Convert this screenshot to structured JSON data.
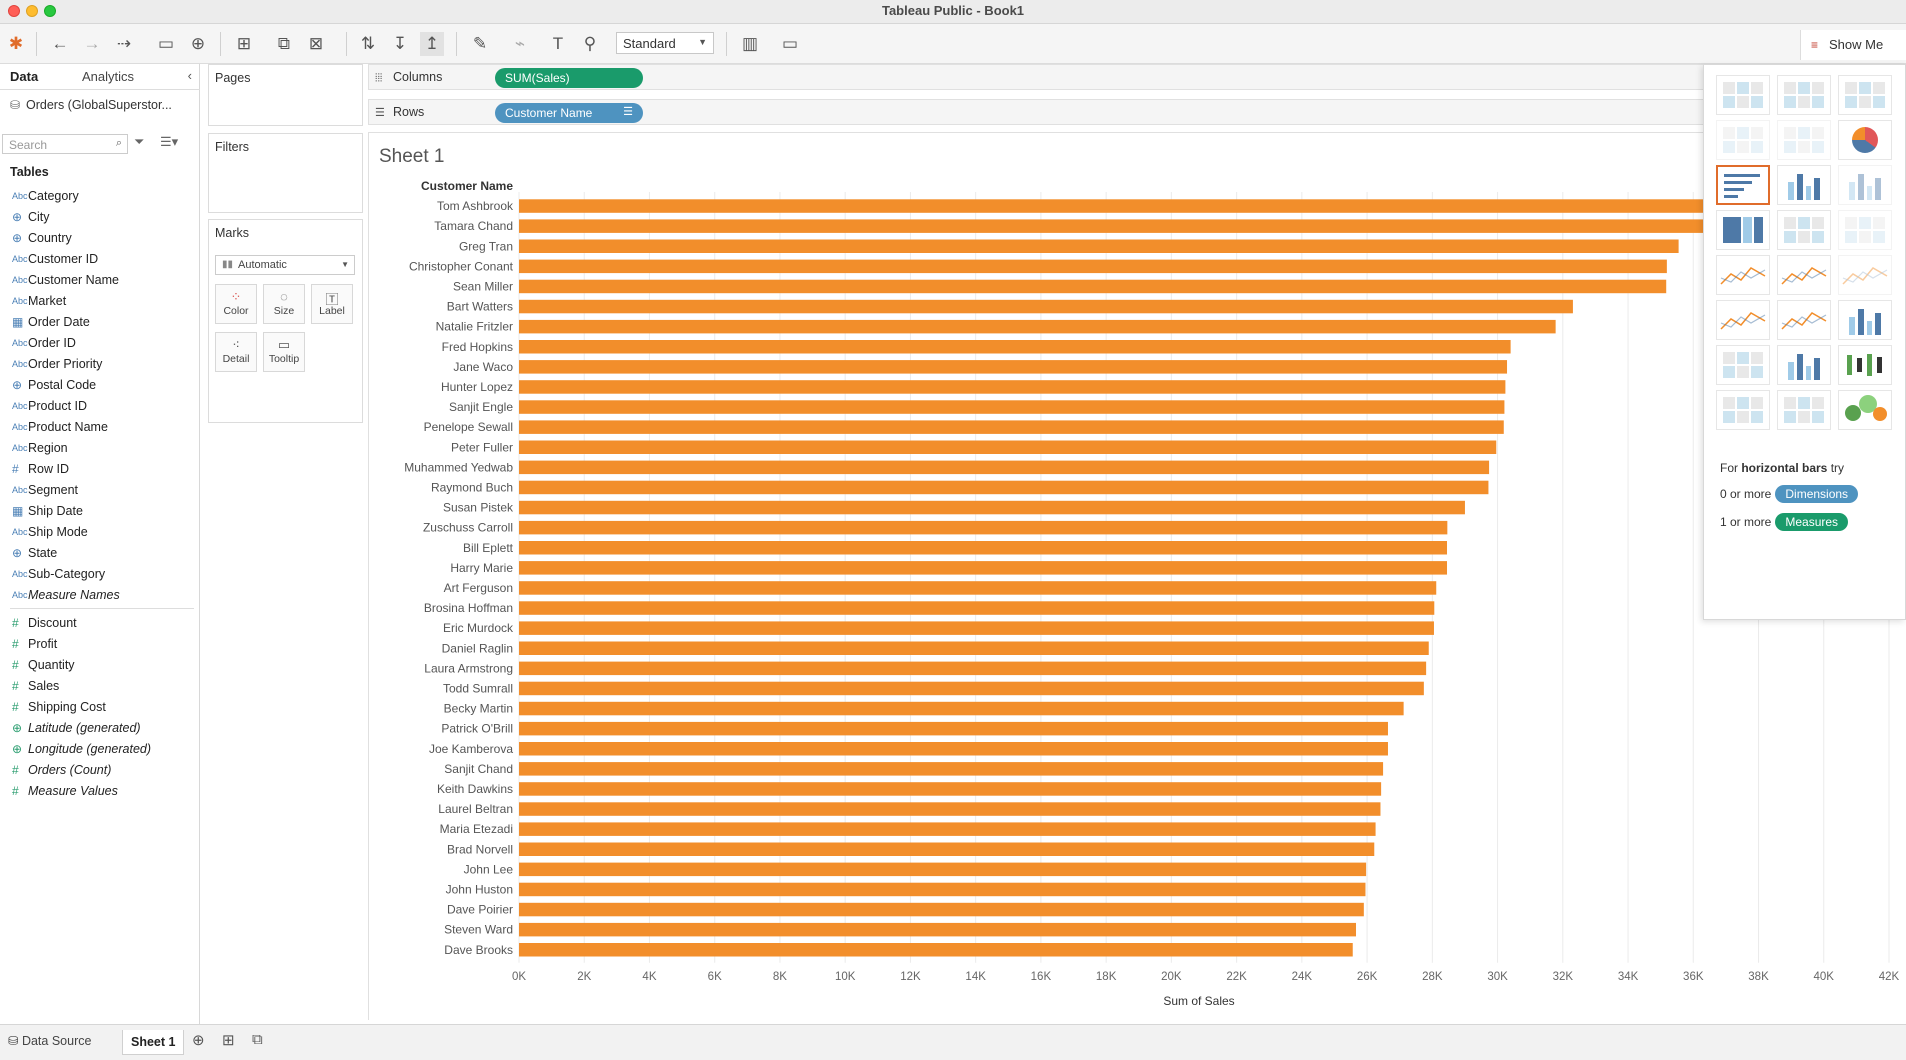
{
  "window": {
    "title": "Tableau Public - Book1"
  },
  "toolbar": {
    "fit_select": "Standard",
    "show_me_label": "Show Me"
  },
  "data_pane": {
    "tab_data": "Data",
    "tab_analytics": "Analytics",
    "datasource": "Orders (GlobalSuperstor...",
    "search_placeholder": "Search",
    "tables_heading": "Tables",
    "dimensions": [
      {
        "icon": "Abc",
        "name": "Category",
        "type": "string"
      },
      {
        "icon": "geo",
        "name": "City",
        "type": "geo"
      },
      {
        "icon": "geo",
        "name": "Country",
        "type": "geo"
      },
      {
        "icon": "Abc",
        "name": "Customer ID",
        "type": "string"
      },
      {
        "icon": "Abc",
        "name": "Customer Name",
        "type": "string"
      },
      {
        "icon": "Abc",
        "name": "Market",
        "type": "string"
      },
      {
        "icon": "date",
        "name": "Order Date",
        "type": "date"
      },
      {
        "icon": "Abc",
        "name": "Order ID",
        "type": "string"
      },
      {
        "icon": "Abc",
        "name": "Order Priority",
        "type": "string"
      },
      {
        "icon": "geo",
        "name": "Postal Code",
        "type": "geo"
      },
      {
        "icon": "Abc",
        "name": "Product ID",
        "type": "string"
      },
      {
        "icon": "Abc",
        "name": "Product Name",
        "type": "string"
      },
      {
        "icon": "Abc",
        "name": "Region",
        "type": "string"
      },
      {
        "icon": "#",
        "name": "Row ID",
        "type": "number"
      },
      {
        "icon": "Abc",
        "name": "Segment",
        "type": "string"
      },
      {
        "icon": "date",
        "name": "Ship Date",
        "type": "date"
      },
      {
        "icon": "Abc",
        "name": "Ship Mode",
        "type": "string"
      },
      {
        "icon": "geo",
        "name": "State",
        "type": "geo"
      },
      {
        "icon": "Abc",
        "name": "Sub-Category",
        "type": "string"
      },
      {
        "icon": "Abc",
        "name": "Measure Names",
        "type": "string",
        "italic": true
      }
    ],
    "measures": [
      {
        "icon": "#",
        "name": "Discount"
      },
      {
        "icon": "#",
        "name": "Profit"
      },
      {
        "icon": "#",
        "name": "Quantity"
      },
      {
        "icon": "#",
        "name": "Sales"
      },
      {
        "icon": "#",
        "name": "Shipping Cost"
      },
      {
        "icon": "geo",
        "name": "Latitude (generated)",
        "italic": true
      },
      {
        "icon": "geo",
        "name": "Longitude (generated)",
        "italic": true
      },
      {
        "icon": "#",
        "name": "Orders (Count)",
        "italic": true
      },
      {
        "icon": "#",
        "name": "Measure Values",
        "italic": true
      }
    ]
  },
  "cards": {
    "pages": "Pages",
    "filters": "Filters",
    "marks": "Marks",
    "mark_type": "Automatic",
    "mark_buttons": [
      "Color",
      "Size",
      "Label",
      "Detail",
      "Tooltip"
    ]
  },
  "shelves": {
    "columns_label": "Columns",
    "columns_pill": "SUM(Sales)",
    "rows_label": "Rows",
    "rows_pill": "Customer Name"
  },
  "sheet": {
    "title": "Sheet 1"
  },
  "chart_data": {
    "type": "bar",
    "orientation": "horizontal",
    "row_header": "Customer Name",
    "xlabel": "Sum of Sales",
    "xlim": [
      0,
      42000
    ],
    "ticks": [
      "0K",
      "2K",
      "4K",
      "6K",
      "8K",
      "10K",
      "12K",
      "14K",
      "16K",
      "18K",
      "20K",
      "22K",
      "24K",
      "26K",
      "28K",
      "30K",
      "32K",
      "34K",
      "36K",
      "38K",
      "40K",
      "42K"
    ],
    "bar_color": "#f28e2b",
    "grid": true,
    "categories": [
      "Tom Ashbrook",
      "Tamara Chand",
      "Greg Tran",
      "Christopher Conant",
      "Sean Miller",
      "Bart Watters",
      "Natalie Fritzler",
      "Fred Hopkins",
      "Jane Waco",
      "Hunter Lopez",
      "Sanjit Engle",
      "Penelope Sewall",
      "Peter Fuller",
      "Muhammed Yedwab",
      "Raymond Buch",
      "Susan Pistek",
      "Zuschuss Carroll",
      "Bill Eplett",
      "Harry Marie",
      "Art Ferguson",
      "Brosina Hoffman",
      "Eric Murdock",
      "Daniel Raglin",
      "Laura Armstrong",
      "Todd Sumrall",
      "Becky Martin",
      "Patrick O'Brill",
      "Joe Kamberova",
      "Sanjit Chand",
      "Keith Dawkins",
      "Laurel Beltran",
      "Maria Etezadi",
      "Brad Norvell",
      "John Lee",
      "John Huston",
      "Dave Poirier",
      "Steven Ward",
      "Dave Brooks"
    ],
    "values": [
      40490,
      37460,
      35550,
      35190,
      35170,
      32310,
      31780,
      30400,
      30290,
      30240,
      30210,
      30190,
      29960,
      29740,
      29720,
      29000,
      28460,
      28450,
      28450,
      28120,
      28060,
      28050,
      27890,
      27810,
      27740,
      27120,
      26640,
      26640,
      26490,
      26430,
      26410,
      26260,
      26220,
      25970,
      25950,
      25900,
      25660,
      25560
    ]
  },
  "show_me": {
    "hint_prefix": "For ",
    "hint_bold": "horizontal bars",
    "hint_suffix": " try",
    "req1_prefix": "0 or more",
    "req1_pill": "Dimensions",
    "req2_prefix": "1 or more",
    "req2_pill": "Measures"
  },
  "bottom_bar": {
    "datasource_tab": "Data Source",
    "sheet_tab": "Sheet 1"
  }
}
